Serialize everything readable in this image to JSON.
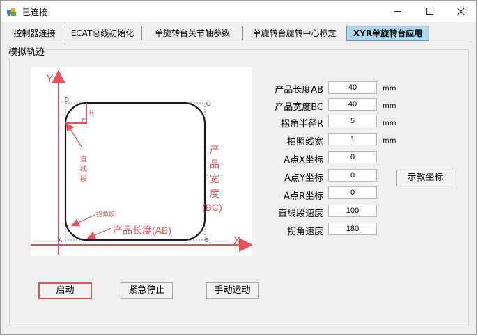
{
  "window": {
    "title": "已连接"
  },
  "tabs": [
    {
      "label": "控制器连接"
    },
    {
      "label": "ECAT总线初始化"
    },
    {
      "label": "单旋转台关节轴参数"
    },
    {
      "label": "单旋转台旋转中心标定"
    },
    {
      "label": "XYR单旋转台应用",
      "active": true
    }
  ],
  "group": {
    "title": "模拟轨迹"
  },
  "diagram": {
    "axis_y": "Y",
    "axis_x": "X",
    "corners": {
      "a": "A",
      "b": "B",
      "c": "C",
      "d": "D"
    },
    "radius_label": "R",
    "straight_label": [
      "直",
      "线",
      "段"
    ],
    "corner_label": "拐角段",
    "length_label": "产品长度(AB)",
    "width_label": [
      "产",
      "品",
      "宽",
      "度",
      "(BC)"
    ],
    "colors": {
      "accent": "#e8505b",
      "outline": "#1a1a1a"
    }
  },
  "params": [
    {
      "label": "产品长度AB",
      "value": "40",
      "unit": "mm"
    },
    {
      "label": "产品宽度BC",
      "value": "40",
      "unit": "mm"
    },
    {
      "label": "拐角半径R",
      "value": "5",
      "unit": "mm"
    },
    {
      "label": "拍照线宽",
      "value": "1",
      "unit": "mm"
    },
    {
      "label": "A点X坐标",
      "value": "0"
    },
    {
      "label": "A点Y坐标",
      "value": "0"
    },
    {
      "label": "A点R坐标",
      "value": "0"
    },
    {
      "label": "直线段速度",
      "value": "100"
    },
    {
      "label": "拐角速度",
      "value": "180"
    }
  ],
  "teach_button": "示教坐标",
  "buttons": {
    "start": "启动",
    "estop": "紧急停止",
    "manual": "手动运动"
  }
}
